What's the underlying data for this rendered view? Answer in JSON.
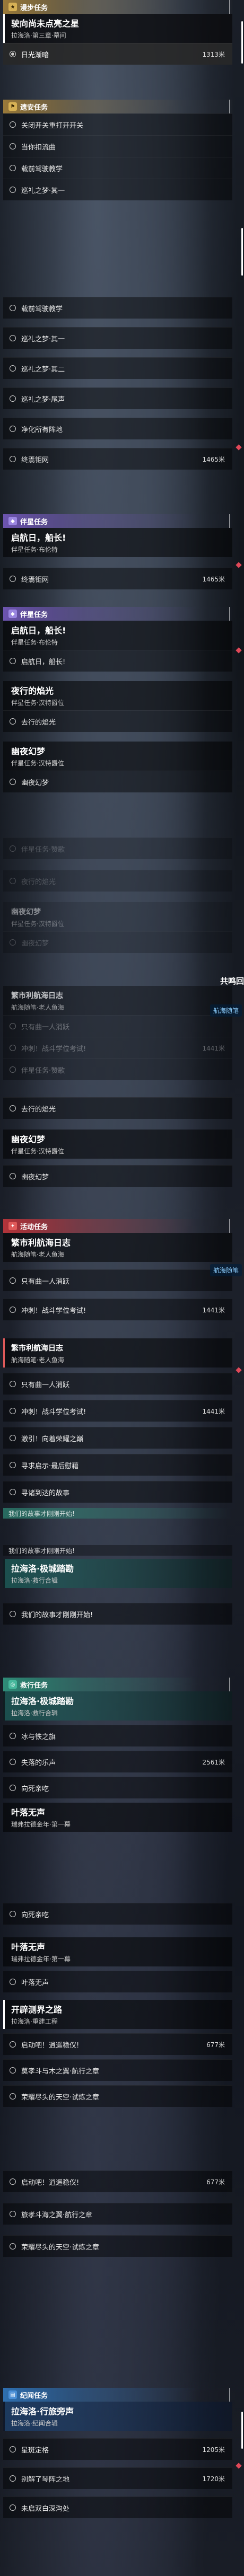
{
  "sec1": {
    "header": "漫步任务",
    "title": "驶向尚未点亮之星",
    "sub": "拉海洛·第三章·幕间",
    "obj": "日光渐暗",
    "dist": "1313米"
  },
  "sec2": {
    "header": "遗安任务",
    "items": [
      "关闭开关重打开开关",
      "当你扣流曲",
      "载前驾驶教学",
      "巡礼之梦·其一"
    ]
  },
  "sec3": {
    "items": [
      "载前驾驶教学",
      "巡礼之梦·其一",
      "巡礼之梦·其二",
      "巡礼之梦·尾声",
      "净化所有阵地",
      "终焉钜网"
    ],
    "dist": "1465米"
  },
  "sec4": {
    "header": "伴星任务",
    "title": "启航日，船长!",
    "sub": "伴星任务·布伦特",
    "obj": "终焉钜网",
    "dist": "1465米"
  },
  "sec5": {
    "header": "伴星任务",
    "q1_title": "启航日，船长!",
    "q1_sub": "伴星任务·布伦特",
    "q1_obj": "启航日，船长!",
    "q2_title": "夜行的焰光",
    "q2_sub": "伴星任务·汉特爵位",
    "q2_obj": "去行的焰光",
    "q3_title": "幽夜幻梦",
    "q3_sub": "伴星任务·汉特爵位",
    "q3_obj": "幽夜幻梦"
  },
  "sec6": {
    "f1": "伴星任务·赞歌",
    "f2": "夜行的焰光",
    "f3": "幽夜幻梦",
    "f4": "伴星任务·汉特爵位",
    "f5": "幽夜幻梦",
    "q_title": "繁市利航海日志",
    "q_sub": "航海随笔·老人鱼海",
    "side": "共鸣回",
    "toast": "航海随笔",
    "obj1": "只有曲一人消跃",
    "obj2": "冲刺！战斗学位考试!",
    "obj2_dist": "1441米",
    "obj3": "伴星任务·赞歌"
  },
  "sec7": {
    "obj1": "去行的焰光",
    "q_title": "幽夜幻梦",
    "q_sub": "伴星任务·汉特爵位",
    "obj2": "幽夜幻梦"
  },
  "sec8": {
    "header": "活动任务",
    "q_title": "繁市利航海日志",
    "q_sub": "航海随笔·老人鱼海",
    "toast": "航海随笔",
    "obj1": "只有曲一人消跃",
    "obj2": "冲刺！战斗学位考试!",
    "obj2_dist": "1441米"
  },
  "sec9": {
    "q_title": "繁市利航海日志",
    "q_sub": "航海随笔·老人鱼海",
    "obj1": "只有曲一人消跃",
    "obj2": "冲刺！战斗学位考试!",
    "obj2_dist": "1441米",
    "obj3": "激引！向着荣耀之巅",
    "obj4": "寻求启示·最后慰藉",
    "obj5": "寻诸到达的故事",
    "obj6": "我们的故事才刚刚开始!"
  },
  "sec10": {
    "header": "我们的故事才刚刚开始!",
    "q_title": "拉海洛·极城踏勘",
    "q_sub": "拉海洛·救行合辑",
    "obj": "我们的故事才刚刚开始!"
  },
  "sec11": {
    "header": "救行任务",
    "q_title": "拉海洛·极城踏勘",
    "q_sub": "拉海洛·救行合辑",
    "obj1": "冰与铁之旗",
    "obj2": "失落的乐声",
    "obj2_dist": "2561米",
    "obj3": "向死亲吃",
    "q2_title": "叶落无声",
    "q2_sub": "瑞弗拉德金年·第一幕"
  },
  "sec12": {
    "obj0": "向死亲吃",
    "q_title": "叶落无声",
    "q_sub": "瑞弗拉德金年·第一幕",
    "obj1": "叶落无声",
    "q2_title": "开辟测界之路",
    "q2_sub": "拉海洛·重建工程",
    "obj2": "启动吧！逍遥稳仪!",
    "obj2_dist": "677米",
    "obj3": "莫孝斗与木之翼·航行之章",
    "obj4": "荣耀尽头的天空·试炼之章"
  },
  "sec13": {
    "obj1": "启动吧！逍遥稳仪!",
    "obj1_dist": "677米",
    "obj2": "旅孝斗海之翼·航行之章",
    "obj3": "荣耀尽头的天空·试炼之章"
  },
  "sec14": {
    "header": "纪闻任务",
    "q_title": "拉海洛·行旅旁声",
    "q_sub": "拉海洛·纪闻合辑",
    "obj1": "星斑定格",
    "obj1_dist": "1205米",
    "obj2": "别解了琴阵之地",
    "obj2_dist": "1720米",
    "obj3": "未启双白深沟处"
  }
}
